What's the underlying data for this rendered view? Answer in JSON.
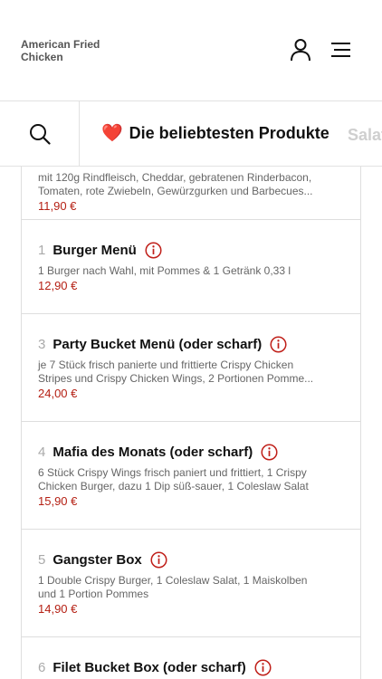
{
  "header": {
    "brand": "American Fried Chicken",
    "icons": {
      "user": "user-icon",
      "menu": "hamburger-menu-icon"
    }
  },
  "categories": {
    "search_icon": "search-icon",
    "active": {
      "icon": "heart-icon",
      "emoji": "❤️",
      "label": "Die beliebtesten Produkte"
    },
    "next": {
      "label": "Salat"
    }
  },
  "colors": {
    "price": "#b52014",
    "info": "#c0201a",
    "heart": "#d0201c"
  },
  "products": [
    {
      "number": "",
      "title": "",
      "description_line1": "mit 120g Rindfleisch, Cheddar, gebratenen Rinderbacon,",
      "description_line2": "Tomaten, rote Zwiebeln, Gewürzgurken und Barbecues...",
      "price": "11,90 €"
    },
    {
      "number": "1",
      "title": "Burger Menü",
      "description": "1 Burger nach Wahl,  mit Pommes & 1 Getränk 0,33 l",
      "price": "12,90 €"
    },
    {
      "number": "3",
      "title": "Party Bucket Menü (oder scharf)",
      "description": "je 7 Stück frisch panierte und frittierte Crispy Chicken\nStripes und Crispy Chicken Wings, 2 Portionen Pomme...",
      "price": "24,00 €"
    },
    {
      "number": "4",
      "title": "Mafia des Monats (oder scharf)",
      "description": "6 Stück Crispy Wings frisch paniert und frittiert, 1 Crispy\nChicken Burger, dazu 1 Dip süß-sauer, 1 Coleslaw Salat",
      "price": "15,90 €"
    },
    {
      "number": "5",
      "title": "Gangster Box",
      "description": "1 Double Crispy Burger, 1 Coleslaw Salat, 1 Maiskolben\nund 1 Portion Pommes",
      "price": "14,90 €"
    },
    {
      "number": "6",
      "title": "Filet Bucket Box (oder scharf)",
      "description": "",
      "price": ""
    }
  ]
}
